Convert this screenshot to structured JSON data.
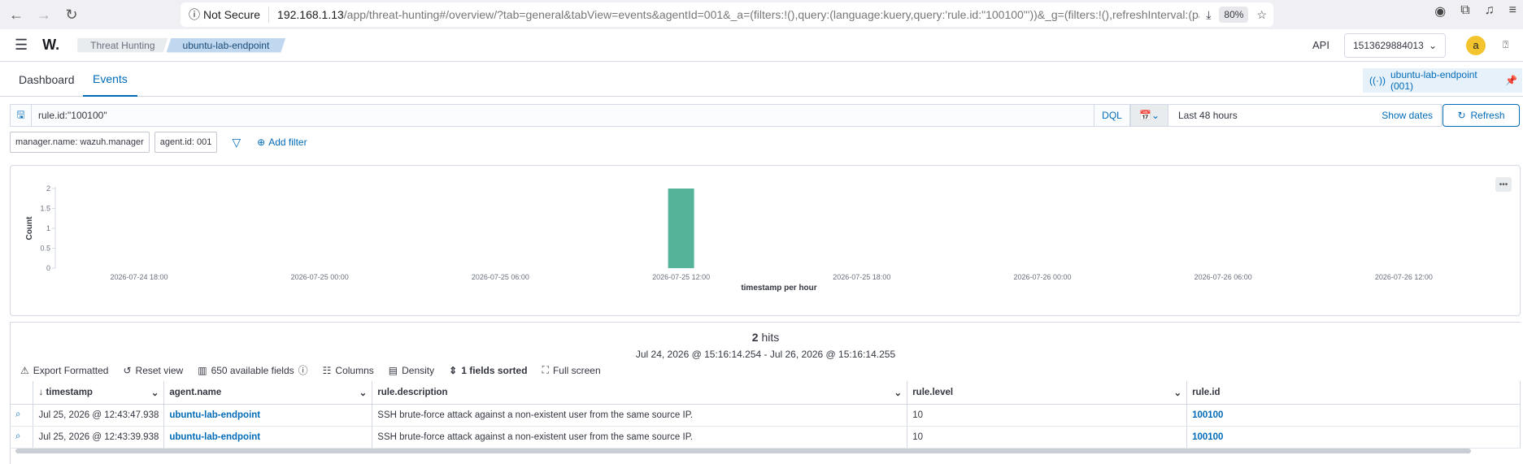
{
  "browser": {
    "not_secure": "Not Secure",
    "url_host": "192.168.1.13",
    "url_path": "/app/threat-hunting#/overview/?tab=general&tabView=events&agentId=001&_a=(filters:!(),query:(language:kuery,query:'rule.id:\"100100\"'))&_g=(filters:!(),refreshInterval:(pause:!t",
    "zoom": "80%"
  },
  "header": {
    "logo": "W.",
    "breadcrumbs": [
      "Threat Hunting",
      "ubuntu-lab-endpoint"
    ],
    "api_label": "API",
    "api_value": "1513629884013",
    "avatar": "a"
  },
  "tabs": [
    "Dashboard",
    "Events"
  ],
  "agent_pill": "ubuntu-lab-endpoint (001)",
  "search": {
    "query": "rule.id:\"100100\"",
    "language": "DQL",
    "date_range": "Last 48 hours",
    "show_dates": "Show dates",
    "refresh": "Refresh"
  },
  "filters": {
    "pills": [
      "manager.name: wazuh.manager",
      "agent.id: 001"
    ],
    "add_filter": "Add filter"
  },
  "chart_data": {
    "type": "bar",
    "ylabel": "Count",
    "xlabel": "timestamp per hour",
    "yticks": [
      "0",
      "0.5",
      "1",
      "1.5",
      "2"
    ],
    "xticks": [
      "2026-07-24 18:00",
      "2026-07-25 00:00",
      "2026-07-25 06:00",
      "2026-07-25 12:00",
      "2026-07-25 18:00",
      "2026-07-26 00:00",
      "2026-07-26 06:00",
      "2026-07-26 12:00"
    ],
    "ylim": [
      0,
      2
    ],
    "bars": [
      {
        "x": "2026-07-25 12:00",
        "value": 2
      }
    ],
    "color": "#54b399"
  },
  "results": {
    "hits_number": "2",
    "hits_word": "hits",
    "range": "Jul 24, 2026 @ 15:16:14.254 - Jul 26, 2026 @ 15:16:14.255",
    "toolbar": {
      "export": "Export Formatted",
      "reset": "Reset view",
      "fields": "650 available fields",
      "columns": "Columns",
      "density": "Density",
      "sorted": "1 fields sorted",
      "fullscreen": "Full screen"
    },
    "columns": [
      "timestamp",
      "agent.name",
      "rule.description",
      "rule.level",
      "rule.id"
    ],
    "rows": [
      [
        "Jul 25, 2026 @ 12:43:47.938",
        "ubuntu-lab-endpoint",
        "SSH brute-force attack against a non-existent user from the same source IP.",
        "10",
        "100100"
      ],
      [
        "Jul 25, 2026 @ 12:43:39.938",
        "ubuntu-lab-endpoint",
        "SSH brute-force attack against a non-existent user from the same source IP.",
        "10",
        "100100"
      ]
    ]
  }
}
